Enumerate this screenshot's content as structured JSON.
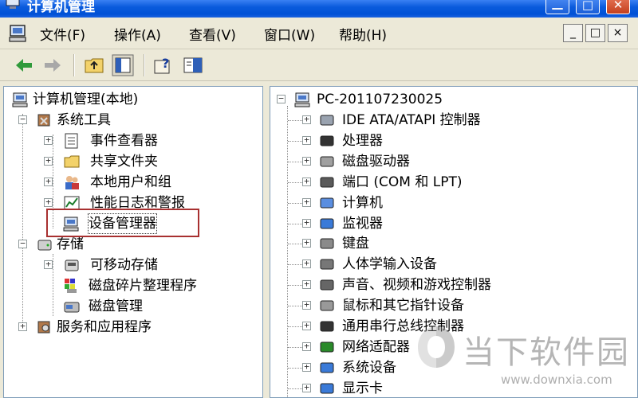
{
  "window": {
    "title": "计算机管理"
  },
  "menu": [
    {
      "label": "文件(F)"
    },
    {
      "label": "操作(A)"
    },
    {
      "label": "查看(V)"
    },
    {
      "label": "窗口(W)"
    },
    {
      "label": "帮助(H)"
    }
  ],
  "mdi_buttons": [
    "_",
    "□",
    "×"
  ],
  "left_tree": {
    "root": "计算机管理(本地)",
    "system_tools": "系统工具",
    "event_viewer": "事件查看器",
    "shared_folders": "共享文件夹",
    "local_users": "本地用户和组",
    "perf_logs": "性能日志和警报",
    "device_manager": "设备管理器",
    "storage": "存储",
    "removable_storage": "可移动存储",
    "defrag": "磁盘碎片整理程序",
    "disk_mgmt": "磁盘管理",
    "services_apps": "服务和应用程序"
  },
  "right_tree": {
    "root": "PC-201107230025",
    "items": [
      "IDE ATA/ATAPI 控制器",
      "处理器",
      "磁盘驱动器",
      "端口 (COM 和 LPT)",
      "计算机",
      "监视器",
      "键盘",
      "人体学输入设备",
      "声音、视频和游戏控制器",
      "鼠标和其它指针设备",
      "通用串行总线控制器",
      "网络适配器",
      "系统设备",
      "显示卡"
    ]
  },
  "watermark": {
    "name": "当下软件园",
    "url": "www.downxia.com"
  }
}
